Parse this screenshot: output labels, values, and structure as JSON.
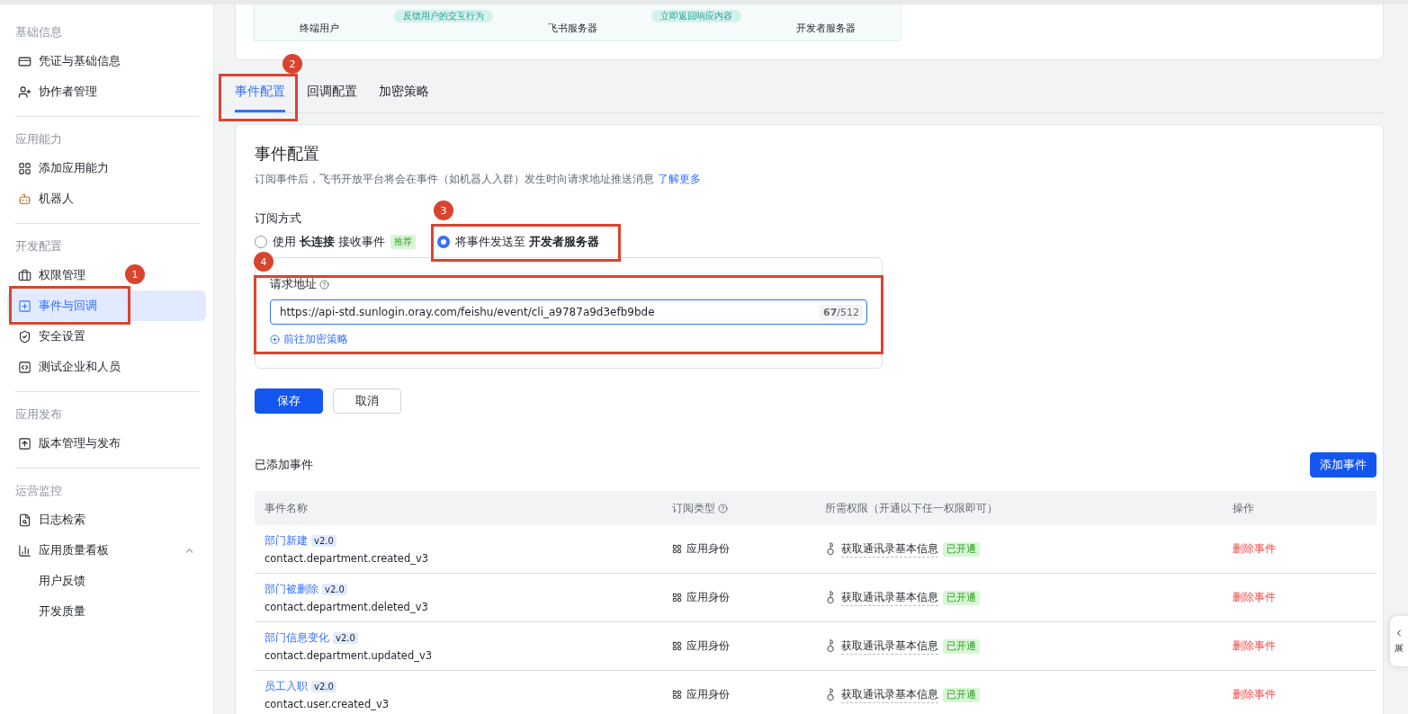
{
  "top_diagram": {
    "nodes": [
      "终端用户",
      "飞书服务器",
      "开发者服务器"
    ],
    "arrows": [
      "反馈用户的交互行为",
      "立即返回响应内容"
    ]
  },
  "sidebar": {
    "sections": [
      {
        "title": "基础信息",
        "items": [
          {
            "label": "凭证与基础信息",
            "selected": false
          },
          {
            "label": "协作者管理",
            "selected": false
          }
        ]
      },
      {
        "title": "应用能力",
        "items": [
          {
            "label": "添加应用能力",
            "selected": false
          },
          {
            "label": "机器人",
            "selected": false
          }
        ]
      },
      {
        "title": "开发配置",
        "items": [
          {
            "label": "权限管理",
            "selected": false
          },
          {
            "label": "事件与回调",
            "selected": true
          },
          {
            "label": "安全设置",
            "selected": false
          },
          {
            "label": "测试企业和人员",
            "selected": false
          }
        ]
      },
      {
        "title": "应用发布",
        "items": [
          {
            "label": "版本管理与发布",
            "selected": false
          }
        ]
      },
      {
        "title": "运营监控",
        "items": [
          {
            "label": "日志检索",
            "selected": false
          },
          {
            "label": "应用质量看板",
            "selected": false,
            "expanded": true,
            "children": [
              {
                "label": "用户反馈",
                "selected": false
              },
              {
                "label": "开发质量",
                "selected": false
              }
            ]
          }
        ]
      }
    ]
  },
  "annotations": [
    "1",
    "2",
    "3",
    "4"
  ],
  "tabs": [
    {
      "label": "事件配置",
      "selected": true
    },
    {
      "label": "回调配置",
      "selected": false
    },
    {
      "label": "加密策略",
      "selected": false
    }
  ],
  "event_config": {
    "title": "事件配置",
    "description": "订阅事件后，飞书开放平台将会在事件（如机器人入群）发生时向请求地址推送消息",
    "learn_more": "了解更多",
    "subscription_label": "订阅方式",
    "options": [
      {
        "label": "使用 **长连接** 接收事件",
        "tag": "推荐",
        "selected": false
      },
      {
        "label": "将事件发送至 **开发者服务器**",
        "selected": true
      }
    ],
    "url_label": "请求地址",
    "url_value": "https://api-std.sunlogin.oray.com/feishu/event/cli_a9787a9d3efb9bde",
    "url_counter": "**67**/512",
    "encrypt_link": "前往加密策略",
    "save": "保存",
    "cancel": "取消"
  },
  "events": {
    "title": "已添加事件",
    "add_button": "添加事件",
    "columns": [
      "事件名称",
      "订阅类型",
      "所需权限（开通以下任一权限即可）",
      "操作"
    ],
    "rows": [
      {
        "name": "部门新建",
        "version": "v2.0",
        "key": "contact.department.created_v3",
        "type": "应用身份",
        "permission": "获取通讯录基本信息",
        "status": "已开通",
        "action": "删除事件"
      },
      {
        "name": "部门被删除",
        "version": "v2.0",
        "key": "contact.department.deleted_v3",
        "type": "应用身份",
        "permission": "获取通讯录基本信息",
        "status": "已开通",
        "action": "删除事件"
      },
      {
        "name": "部门信息变化",
        "version": "v2.0",
        "key": "contact.department.updated_v3",
        "type": "应用身份",
        "permission": "获取通讯录基本信息",
        "status": "已开通",
        "action": "删除事件"
      },
      {
        "name": "员工入职",
        "version": "v2.0",
        "key": "contact.user.created_v3",
        "type": "应用身份",
        "permission": "获取通讯录基本信息",
        "status": "已开通",
        "action": "删除事件"
      }
    ]
  },
  "side_tab": {
    "label": "展"
  }
}
